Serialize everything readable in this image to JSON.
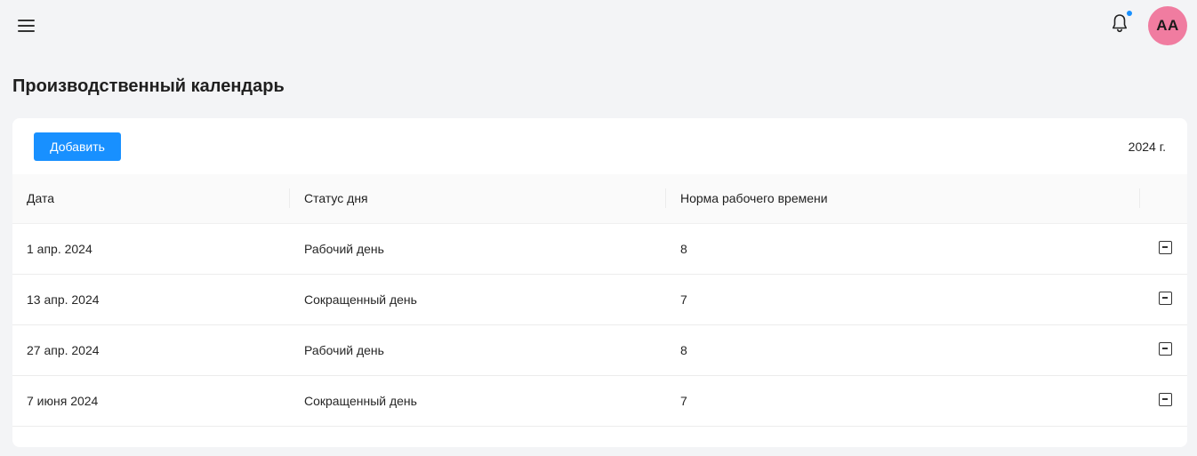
{
  "header": {
    "menu_icon": "hamburger-icon",
    "notification_icon": "bell-icon",
    "notification_dot_color": "#1890ff",
    "avatar_initials": "AA",
    "avatar_color": "#f07ca0"
  },
  "page": {
    "title": "Производственный календарь"
  },
  "toolbar": {
    "add_label": "Добавить",
    "year": "2024 г."
  },
  "table": {
    "columns": [
      "Дата",
      "Статус дня",
      "Норма рабочего времени",
      ""
    ],
    "rows": [
      {
        "date": "1 апр. 2024",
        "status": "Рабочий день",
        "norm": "8"
      },
      {
        "date": "13 апр. 2024",
        "status": "Сокращенный день",
        "norm": "7"
      },
      {
        "date": "27 апр. 2024",
        "status": "Рабочий день",
        "norm": "8"
      },
      {
        "date": "7 июня 2024",
        "status": "Сокращенный день",
        "norm": "7"
      }
    ],
    "row_action_icon": "minus-square-icon"
  },
  "colors": {
    "accent": "#1890ff",
    "background": "#f3f4f6"
  }
}
